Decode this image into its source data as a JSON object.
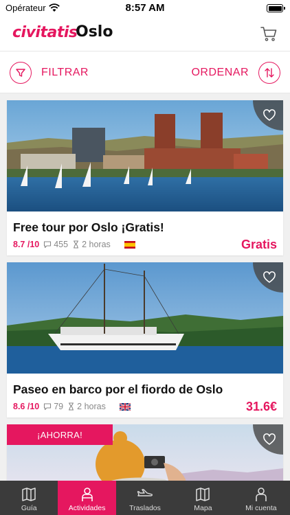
{
  "status_bar": {
    "carrier": "Opérateur",
    "time": "8:57 AM"
  },
  "header": {
    "brand": "civitatis",
    "city": "Oslo"
  },
  "toolbar": {
    "filter_label": "FILTRAR",
    "sort_label": "ORDENAR"
  },
  "activities": [
    {
      "title": "Free tour por Oslo ¡Gratis!",
      "rating": "8.7 /10",
      "reviews": "455",
      "duration": "2 horas",
      "language_flag": "spain-flag",
      "price": "Gratis"
    },
    {
      "title": "Paseo en barco por el fiordo de Oslo",
      "rating": "8.6 /10",
      "reviews": "79",
      "duration": "2 horas",
      "language_flag": "uk-flag",
      "price": "31.6€"
    },
    {
      "badge": "¡AHORRA!"
    }
  ],
  "tabs": [
    {
      "label": "Guía",
      "icon": "map-book-icon",
      "active": false
    },
    {
      "label": "Actividades",
      "icon": "person-icon",
      "active": true
    },
    {
      "label": "Traslados",
      "icon": "plane-icon",
      "active": false
    },
    {
      "label": "Mapa",
      "icon": "map-icon",
      "active": false
    },
    {
      "label": "Mi cuenta",
      "icon": "account-icon",
      "active": false
    }
  ],
  "colors": {
    "brand": "#e5175f",
    "tabbar": "#3b3b3b",
    "background": "#f0f0f0"
  }
}
